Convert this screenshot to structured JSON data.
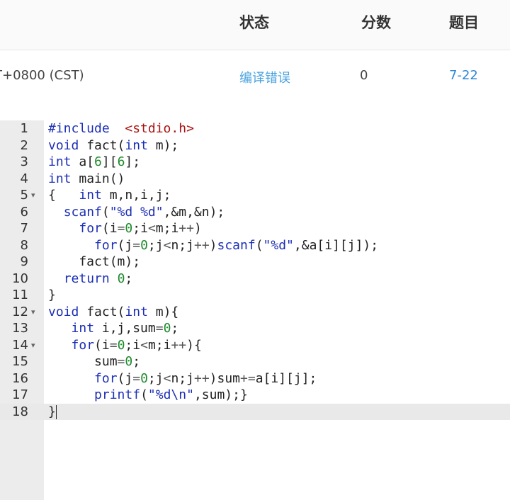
{
  "table_header": {
    "status": "状态",
    "score": "分数",
    "problem": "题目"
  },
  "submission": {
    "time": "T+0800 (CST)",
    "status": "编译错误",
    "score": "0",
    "problem": "7-22"
  },
  "editor": {
    "lines": [
      {
        "n": "1",
        "fold": "",
        "code": "#include  <stdio.h>"
      },
      {
        "n": "2",
        "fold": "",
        "code": "void fact(int m);"
      },
      {
        "n": "3",
        "fold": "",
        "code": "int a[6][6];"
      },
      {
        "n": "4",
        "fold": "",
        "code": "int main()"
      },
      {
        "n": "5",
        "fold": "▾",
        "code": "{   int m,n,i,j;"
      },
      {
        "n": "6",
        "fold": "",
        "code": "  scanf(\"%d %d\",&m,&n);"
      },
      {
        "n": "7",
        "fold": "",
        "code": "    for(i=0;i<m;i++)"
      },
      {
        "n": "8",
        "fold": "",
        "code": "      for(j=0;j<n;j++)scanf(\"%d\",&a[i][j]);"
      },
      {
        "n": "9",
        "fold": "",
        "code": "    fact(m);"
      },
      {
        "n": "10",
        "fold": "",
        "code": "  return 0;"
      },
      {
        "n": "11",
        "fold": "",
        "code": "}"
      },
      {
        "n": "12",
        "fold": "▾",
        "code": "void fact(int m){"
      },
      {
        "n": "13",
        "fold": "",
        "code": "   int i,j,sum=0;"
      },
      {
        "n": "14",
        "fold": "▾",
        "code": "   for(i=0;i<m;i++){"
      },
      {
        "n": "15",
        "fold": "",
        "code": "      sum=0;"
      },
      {
        "n": "16",
        "fold": "",
        "code": "      for(j=0;j<n;j++)sum+=a[i][j];"
      },
      {
        "n": "17",
        "fold": "",
        "code": "      printf(\"%d\\n\",sum);}"
      },
      {
        "n": "18",
        "fold": "",
        "code": "}"
      }
    ],
    "active_line": 18
  }
}
